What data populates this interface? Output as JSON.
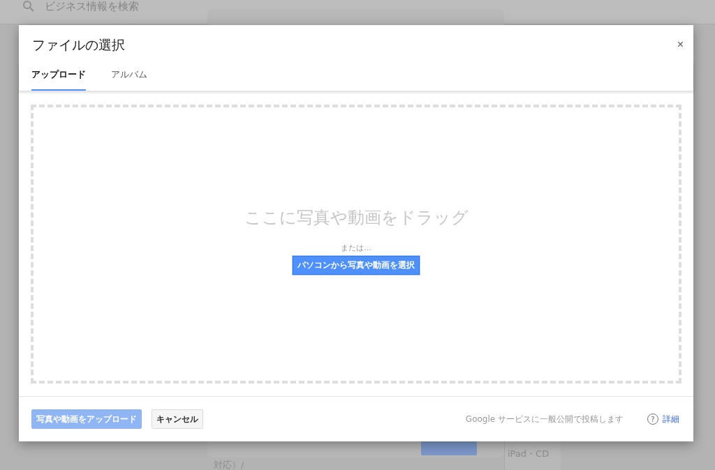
{
  "background": {
    "search": {
      "placeholder": "ビジネス情報を検索"
    },
    "post_card": {
      "fragment_1": "iPad・CD",
      "fragment_2": "対応）/"
    }
  },
  "dialog": {
    "title": "ファイルの選択",
    "close": "×",
    "tabs": [
      {
        "label": "アップロード",
        "selected": true
      },
      {
        "label": "アルバム",
        "selected": false
      }
    ],
    "dropzone": {
      "heading": "ここに写真や動画をドラッグ",
      "or": "または...",
      "button": "パソコンから写真や動画を選択"
    },
    "footer": {
      "buttons": [
        {
          "label": "写真や動画をアップロード",
          "kind": "primary",
          "disabled": true
        },
        {
          "label": "キャンセル",
          "kind": "secondary",
          "disabled": false
        }
      ],
      "notice": "Google サービスに一般公開で投稿します",
      "help": "?",
      "link": "詳細"
    }
  }
}
